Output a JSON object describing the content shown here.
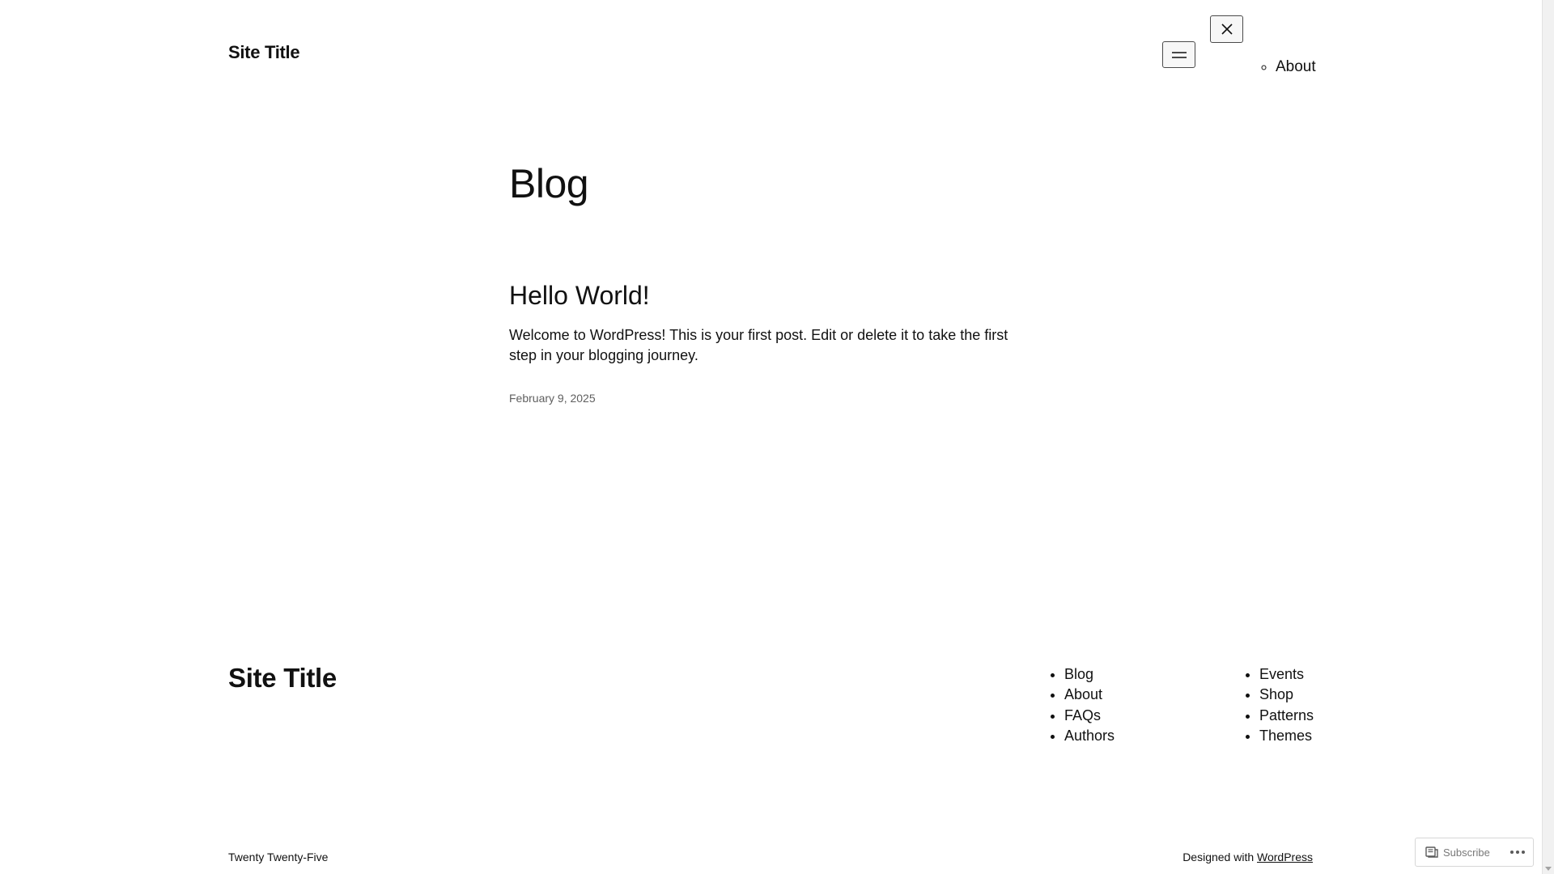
{
  "header": {
    "site_title": "Site Title",
    "open_menu_icon": "hamburger-icon",
    "close_menu_icon": "close-icon",
    "submenu_items": [
      {
        "label": "About"
      }
    ]
  },
  "main": {
    "heading": "Blog",
    "posts": [
      {
        "title": "Hello World!",
        "excerpt": "Welcome to WordPress! This is your first post. Edit or delete it to take the first step in your blogging journey.",
        "date": "February 9, 2025"
      }
    ]
  },
  "footer": {
    "site_title": "Site Title",
    "nav_col1": [
      {
        "label": "Blog"
      },
      {
        "label": "About"
      },
      {
        "label": "FAQs"
      },
      {
        "label": "Authors"
      }
    ],
    "nav_col2": [
      {
        "label": "Events"
      },
      {
        "label": "Shop"
      },
      {
        "label": "Patterns"
      },
      {
        "label": "Themes"
      }
    ],
    "theme_name": "Twenty Twenty-Five",
    "credit_prefix": "Designed with",
    "credit_link": "WordPress"
  },
  "subscribe_bar": {
    "subscribe_label": "Subscribe",
    "subscribe_icon": "reader-icon",
    "more_icon": "ellipsis-icon"
  }
}
